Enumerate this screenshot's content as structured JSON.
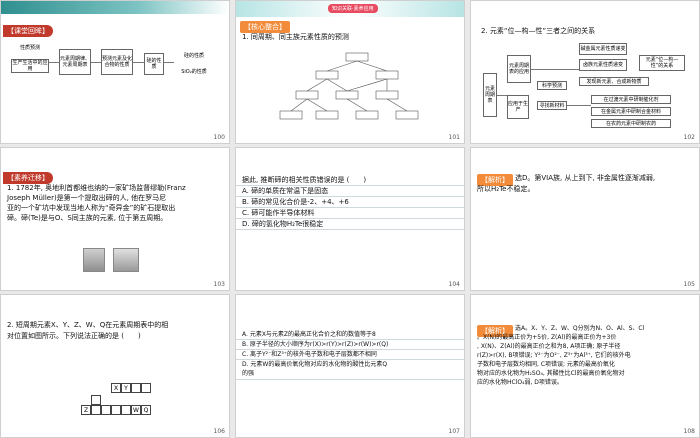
{
  "slides": [
    {
      "page": "100",
      "tag": "【课堂回眸】",
      "boxes": [
        "性质预测",
        "生产生活中的应用",
        "元素周期律、元素周期表",
        "预测元素及化合物的性质",
        "硅的性质",
        "硅的性质",
        "SiO₂的性质"
      ]
    },
    {
      "page": "101",
      "ribbon": "知识关联·素养应用",
      "tag": "【核心整合】",
      "heading": "1. 同周期、同主族元素性质的预测"
    },
    {
      "page": "102",
      "heading": "2. 元素“位—构—性”三者之间的关系",
      "labels": [
        "元素周期表",
        "应用于生产",
        "元素周期表的应用",
        "科学预测",
        "寻找新材料",
        "元素“位—构—性”的关系",
        "碱金属元素性质递变",
        "卤族元素性质递变",
        "发现新元素、合成新物质",
        "在过渡元素中研制催化剂",
        "在金属元素中研制合金材料",
        "在农药元素中研制农药"
      ]
    },
    {
      "page": "103",
      "tag": "【素养迁移】",
      "lines": [
        "1. 1782年, 奥地利首都维也纳的一家矿场监督缪勒(Franz",
        "Joseph Müller)是第一个提取出碲的人, 他在罗马尼",
        "亚的一个矿坑中发现当地人称为“奇异金”的矿石提取出",
        "碲。碲(Te)是与O、S同主族的元素, 位于第五周期。"
      ]
    },
    {
      "page": "104",
      "lines": [
        "据此, 推断碲的相关性质错误的是 (　　)",
        "A. 碲的单质在常温下是固态",
        "B. 碲的常见化合价是-2、+4、+6",
        "C. 碲可能作半导体材料",
        "D. 碲的氢化物H₂Te很稳定"
      ]
    },
    {
      "page": "105",
      "tag": "【解析】",
      "lines": [
        "选D。第VIA族, 从上到下, 非金属性逐渐减弱,",
        "所以H₂Te不稳定。"
      ]
    },
    {
      "page": "106",
      "lines": [
        "2. 短周期元素X、Y、Z、W、Q在元素周期表中的相",
        "对位置如图所示。下列说法正确的是 (　　)"
      ],
      "cells": [
        "X",
        "Y",
        "Z",
        "W",
        "Q"
      ]
    },
    {
      "page": "107",
      "lines": [
        "A. 元素X与元素Z的最高正化合价之和的数值等于8",
        "B. 原子半径的大小顺序为r(X)>r(Y)>r(Z)>r(W)>r(Q)",
        "C. 离子Y²⁻和Z³⁺的核外电子数和电子层数都不相同",
        "D. 元素W的最高价氧化物对应的水化物的酸性比元素Q",
        "的强"
      ]
    },
    {
      "page": "108",
      "tag": "【解析】",
      "lines": [
        "选A。X、Y、Z、W、Q分别为N、O、Al、S、Cl",
        "。X(N)的最高正价为+5价, Z(Al)的最高正价为+3价",
        ", X(N)、Z(Al)的最高正价之和为8, A项正确; 原子半径",
        "r(Z)>r(X), B项错误; Y²⁻为O²⁻, Z³⁺为Al³⁺, 它们的核外电",
        "子数和电子层数均相同, C项错误; 元素的最高价氧化",
        "物对应的水化物为H₂SO₄, 其酸性比Cl的最高价氧化物对",
        "应的水化物HClO₄弱, D项错误。"
      ]
    }
  ],
  "colors": {
    "teal": "#2f8f8f",
    "tag_red": "#c0392b",
    "tag_orange": "#f28c3a",
    "pink": "#e84a5f"
  }
}
